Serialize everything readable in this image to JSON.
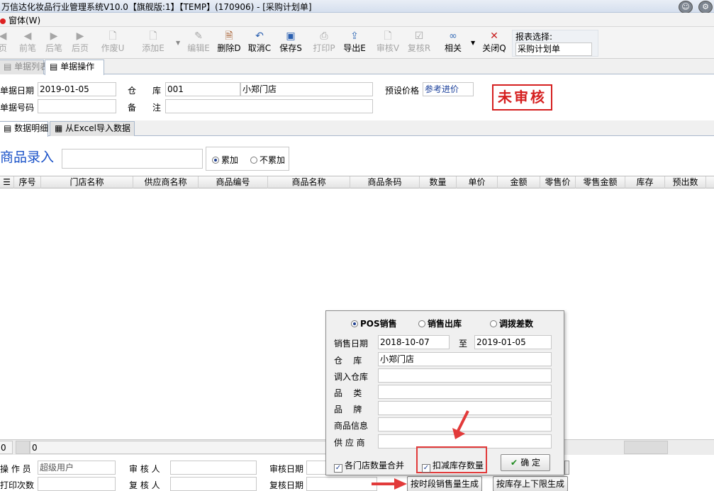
{
  "window": {
    "title": "万信达化妆品行业管理系统V10.0【旗舰版:1】【TEMP】(170906) - [采购计划单]"
  },
  "menu": {
    "item": "窗体(W)"
  },
  "toolbar": {
    "buttons": [
      {
        "label": "页",
        "icon": "first-icon"
      },
      {
        "label": "前笔",
        "icon": "prev-icon"
      },
      {
        "label": "后笔",
        "icon": "next-icon"
      },
      {
        "label": "后页",
        "icon": "last-icon"
      },
      {
        "label": "作废U",
        "icon": "void-icon"
      },
      {
        "label": "添加E",
        "icon": "add-icon"
      },
      {
        "label": "编辑E",
        "icon": "edit-icon"
      },
      {
        "label": "删除D",
        "icon": "delete-icon"
      },
      {
        "label": "取消C",
        "icon": "undo-icon"
      },
      {
        "label": "保存S",
        "icon": "save-icon"
      },
      {
        "label": "打印P",
        "icon": "print-icon"
      },
      {
        "label": "导出E",
        "icon": "export-icon"
      },
      {
        "label": "审核V",
        "icon": "audit-icon"
      },
      {
        "label": "复核R",
        "icon": "recheck-icon"
      },
      {
        "label": "相关",
        "icon": "link-icon"
      },
      {
        "label": "关闭Q",
        "icon": "close-icon"
      }
    ],
    "report_label": "报表选择:",
    "report_value": "采购计划单"
  },
  "tabs": {
    "list": "单据列表",
    "operation": "单据操作"
  },
  "header": {
    "date_label": "单据日期",
    "date_value": "2019-01-05",
    "warehouse_label_1": "仓",
    "warehouse_label_2": "库",
    "warehouse_code": "001",
    "warehouse_name": "小郑门店",
    "price_label": "预设价格",
    "price_value": "参考进价",
    "number_label": "单据号码",
    "number_value": "",
    "remark_label_1": "备",
    "remark_label_2": "注",
    "remark_value": "",
    "status_stamp": "未审核"
  },
  "subtabs": {
    "detail": "数据明细",
    "excel": "从Excel导入数据"
  },
  "entry": {
    "label": "商品录入",
    "value": "",
    "accumulate": "累加",
    "no_accumulate": "不累加"
  },
  "grid": {
    "columns": [
      "序号",
      "门店名称",
      "供应商名称",
      "商品编号",
      "商品名称",
      "商品条码",
      "数量",
      "单价",
      "金额",
      "零售价",
      "零售金额",
      "库存",
      "预出数"
    ]
  },
  "status": {
    "left": "0",
    "count": "0"
  },
  "footer": {
    "operator_label": "操 作 员",
    "operator_value": "超级用户",
    "auditor_label": "审 核 人",
    "auditor_value": "",
    "audit_date_label": "审核日期",
    "audit_date_value": "",
    "print_count_label": "打印次数",
    "print_count_value": "",
    "rechecker_label": "复 核 人",
    "rechecker_value": "",
    "recheck_date_label": "复核日期",
    "recheck_date_value": "",
    "btn_by_period": "按时段销售量生成",
    "btn_by_stock": "按库存上下限生成"
  },
  "popup": {
    "radio_pos": "POS销售",
    "radio_out": "销售出库",
    "radio_transfer": "调拨差数",
    "sale_date_label": "销售日期",
    "sale_date_from": "2018-10-07",
    "to_label": "至",
    "sale_date_to": "2019-01-05",
    "warehouse_label": "仓    库",
    "warehouse_value": "小郑门店",
    "transfer_label": "调入仓库",
    "transfer_value": "",
    "category_label": "品    类",
    "category_value": "",
    "brand_label": "品    牌",
    "brand_value": "",
    "product_info_label": "商品信息",
    "product_info_value": "",
    "supplier_label": "供 应 商",
    "supplier_value": "",
    "merge_label": "各门店数量合并",
    "deduct_label": "扣减库存数量",
    "confirm_label": "确 定"
  }
}
